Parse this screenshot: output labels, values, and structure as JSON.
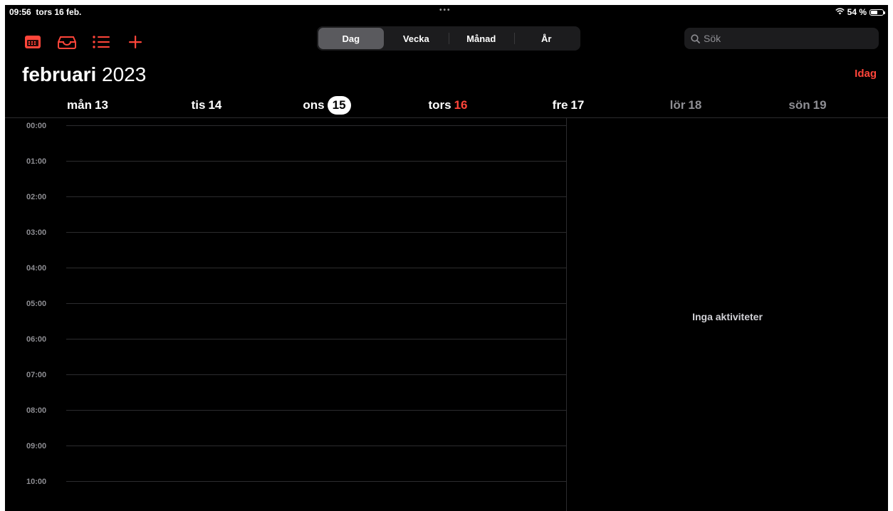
{
  "status_bar": {
    "time": "09:56",
    "date": "tors 16 feb.",
    "multitask": "•••",
    "battery": "54 %",
    "battery_level": 0.54
  },
  "toolbar": {
    "icons": [
      "calendar-icon",
      "inbox-icon",
      "list-icon",
      "plus-icon"
    ],
    "accent": "#ff453a",
    "views": [
      {
        "label": "Dag",
        "active": true
      },
      {
        "label": "Vecka",
        "active": false
      },
      {
        "label": "Månad",
        "active": false
      },
      {
        "label": "År",
        "active": false
      }
    ],
    "search_placeholder": "Sök"
  },
  "header": {
    "month": "februari",
    "year": "2023",
    "today_label": "Idag"
  },
  "days": [
    {
      "name": "mån",
      "num": "13"
    },
    {
      "name": "tis",
      "num": "14"
    },
    {
      "name": "ons",
      "num": "15"
    },
    {
      "name": "tors",
      "num": "16"
    },
    {
      "name": "fre",
      "num": "17"
    },
    {
      "name": "lör",
      "num": "18"
    },
    {
      "name": "sön",
      "num": "19"
    }
  ],
  "hours": [
    "00:00",
    "01:00",
    "02:00",
    "03:00",
    "04:00",
    "05:00",
    "06:00",
    "07:00",
    "08:00",
    "09:00",
    "10:00"
  ],
  "detail": {
    "empty_message": "Inga aktiviteter"
  }
}
